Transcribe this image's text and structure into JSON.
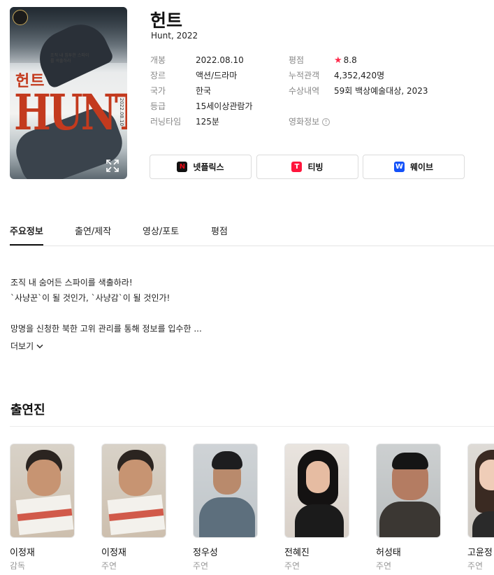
{
  "movie": {
    "title": "헌트",
    "subtitle": "Hunt, 2022",
    "poster": {
      "title_kr": "헌트",
      "title_en": "HUNT",
      "tagline": "조직 내 침투한 스파이를 색출하라",
      "side_date": "2022.08.10"
    }
  },
  "info_left": [
    {
      "label": "개봉",
      "value": "2022.08.10"
    },
    {
      "label": "장르",
      "value": "액션/드라마"
    },
    {
      "label": "국가",
      "value": "한국"
    },
    {
      "label": "등급",
      "value": "15세이상관람가"
    },
    {
      "label": "러닝타임",
      "value": "125분"
    }
  ],
  "info_right": {
    "rating_label": "평점",
    "rating_value": "8.8",
    "audience_label": "누적관객",
    "audience_value": "4,352,420명",
    "award_label": "수상내역",
    "award_value": "59회 백상예술대상, 2023",
    "movieinfo_label": "영화정보",
    "star_color": "#ff2a4b",
    "link_color": "#1f6dd3"
  },
  "ott": [
    {
      "name": "넷플릭스",
      "icon": "netflix-logo-icon",
      "color": "#111111",
      "mark": "N"
    },
    {
      "name": "티빙",
      "icon": "tving-logo-icon",
      "color": "#ff153c",
      "mark": "T"
    },
    {
      "name": "웨이브",
      "icon": "wavve-logo-icon",
      "color": "#1351f9",
      "mark": "W"
    }
  ],
  "tabs": [
    {
      "label": "주요정보",
      "active": true
    },
    {
      "label": "출연/제작",
      "active": false
    },
    {
      "label": "영상/포토",
      "active": false
    },
    {
      "label": "평점",
      "active": false
    }
  ],
  "synopsis": {
    "line1": "조직 내 숨어든 스파이를 색출하라!",
    "line2": "`사냥꾼`이 될 것인가, `사냥감`이 될 것인가!",
    "line3": "망명을 신청한 북한 고위 관리를 통해 정보를 입수한 ...",
    "more_label": "더보기"
  },
  "cast": {
    "title": "출연진",
    "members": [
      {
        "name": "이정재",
        "role": "감독"
      },
      {
        "name": "이정재",
        "role": "주연"
      },
      {
        "name": "정우성",
        "role": "주연"
      },
      {
        "name": "전혜진",
        "role": "주연"
      },
      {
        "name": "허성태",
        "role": "주연"
      },
      {
        "name": "고윤정",
        "role": "주연"
      }
    ]
  }
}
